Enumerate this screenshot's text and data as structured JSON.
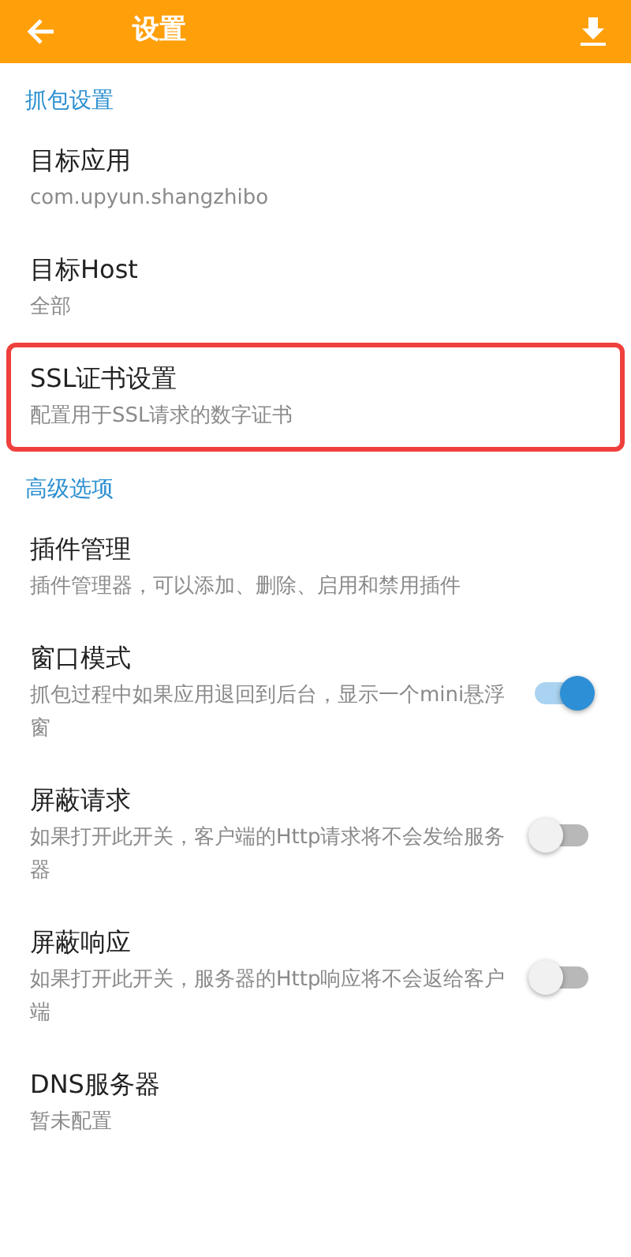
{
  "app_bar": {
    "title": "设置"
  },
  "entries": [
    {
      "kind": "header",
      "label": "抓包设置"
    },
    {
      "kind": "item",
      "title": "目标应用",
      "summary": "com.upyun.shangzhibo",
      "highlighted": false
    },
    {
      "kind": "item",
      "title": "目标Host",
      "summary": "全部",
      "highlighted": false
    },
    {
      "kind": "item",
      "title": "SSL证书设置",
      "summary": "配置用于SSL请求的数字证书",
      "highlighted": true
    },
    {
      "kind": "header",
      "label": "高级选项"
    },
    {
      "kind": "item",
      "title": "插件管理",
      "summary": "插件管理器，可以添加、删除、启用和禁用插件",
      "highlighted": false
    },
    {
      "kind": "switch",
      "title": "窗口模式",
      "summary": "抓包过程中如果应用退回到后台，显示一个mini悬浮窗",
      "on": true
    },
    {
      "kind": "switch",
      "title": "屏蔽请求",
      "summary": "如果打开此开关，客户端的Http请求将不会发给服务器",
      "on": false
    },
    {
      "kind": "switch",
      "title": "屏蔽响应",
      "summary": "如果打开此开关，服务器的Http响应将不会返给客户端",
      "on": false
    },
    {
      "kind": "item",
      "title": "DNS服务器",
      "summary": "暂未配置",
      "highlighted": false
    }
  ]
}
